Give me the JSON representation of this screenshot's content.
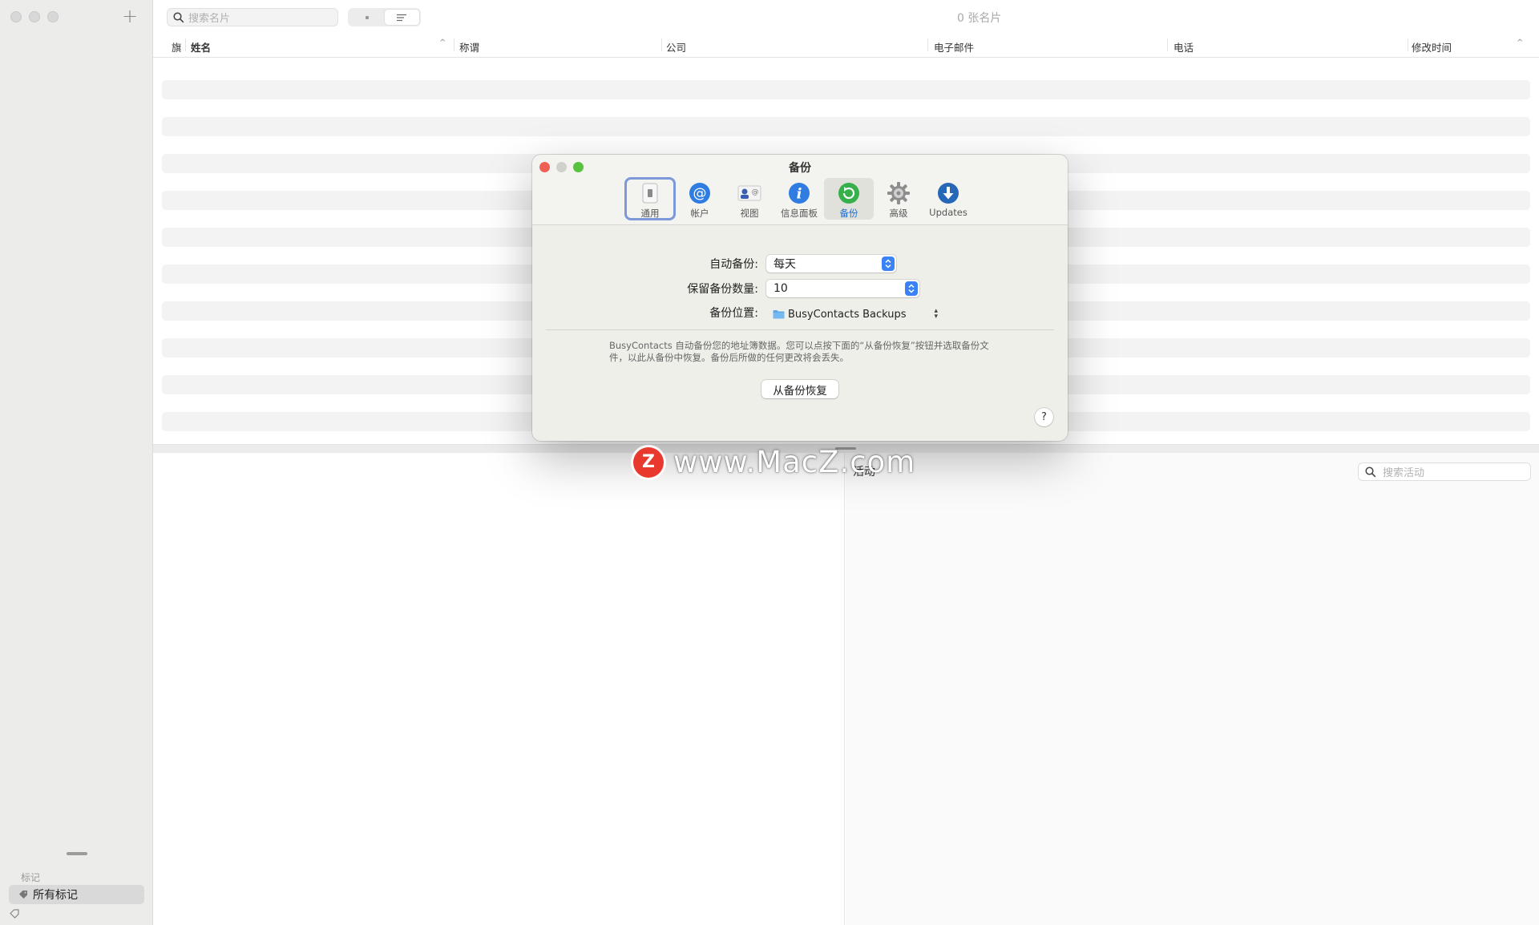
{
  "sidebar": {
    "section_label": "标记",
    "selected_item": "所有标记"
  },
  "toolbar": {
    "search_placeholder": "搜索名片",
    "card_count": "0 张名片"
  },
  "columns": {
    "flag": "旗",
    "name": "姓名",
    "title": "称谓",
    "company": "公司",
    "email": "电子邮件",
    "phone": "电话",
    "modified": "修改时间"
  },
  "activity": {
    "label": "活动",
    "search_placeholder": "搜索活动"
  },
  "prefs": {
    "title": "备份",
    "tabs": [
      "通用",
      "帐户",
      "视图",
      "信息面板",
      "备份",
      "高级",
      "Updates"
    ],
    "active_tab": "备份",
    "auto_backup_label": "自动备份:",
    "auto_backup_value": "每天",
    "keep_count_label": "保留备份数量:",
    "keep_count_value": "10",
    "location_label": "备份位置:",
    "location_value": "BusyContacts Backups",
    "description": "BusyContacts 自动备份您的地址簿数据。您可以点按下面的“从备份恢复”按钮并选取备份文件，以此从备份中恢复。备份后所做的任何更改将会丢失。",
    "restore_button": "从备份恢复",
    "help_button": "?"
  },
  "watermark": {
    "logo_letter": "Z",
    "text": "www.MacZ.com"
  },
  "colors": {
    "accent": "#1b6fd6",
    "close": "#ee5f56",
    "zoom": "#56c23d",
    "watermark_logo": "#e9392f"
  },
  "icons": [
    "plus-icon",
    "search-icon",
    "tag-icon",
    "switch-icon",
    "at-icon",
    "card-icon",
    "info-icon",
    "refresh-icon",
    "gear-icon",
    "download-icon",
    "folder-icon",
    "chevron-updown-icon"
  ]
}
